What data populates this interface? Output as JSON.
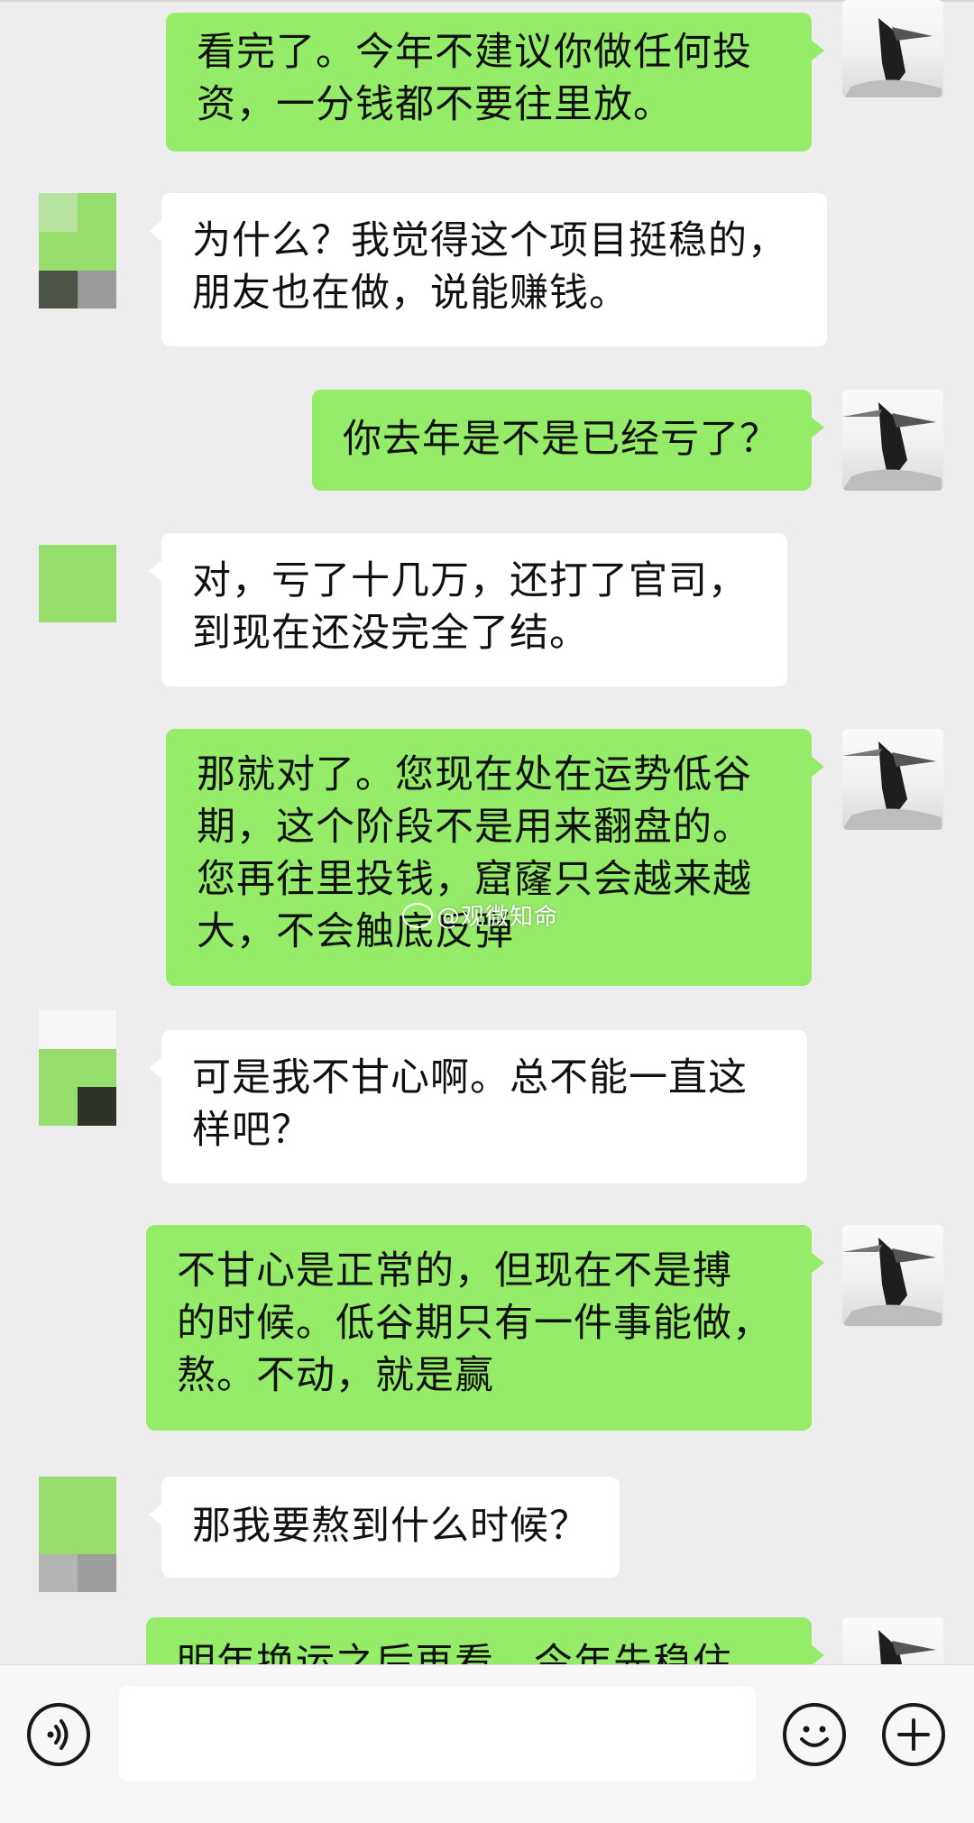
{
  "messages": [
    {
      "side": "out",
      "text": "看完了。今年不建议你做任何投\n资，一分钱都不要往里放。"
    },
    {
      "side": "in",
      "text": "为什么？我觉得这个项目挺稳的，\n朋友也在做，说能赚钱。"
    },
    {
      "side": "out",
      "text": "你去年是不是已经亏了？"
    },
    {
      "side": "in",
      "text": "对，亏了十几万，还打了官司，\n到现在还没完全了结。"
    },
    {
      "side": "out",
      "text": "那就对了。您现在处在运势低谷\n期，这个阶段不是用来翻盘的。\n您再往里投钱，窟窿只会越来越\n大，不会触底反弹"
    },
    {
      "side": "in",
      "text": "可是我不甘心啊。总不能一直这\n样吧？"
    },
    {
      "side": "out",
      "text": "不甘心是正常的，但现在不是搏\n的时候。低谷期只有一件事能做，\n熬。不动，就是赢"
    },
    {
      "side": "in",
      "text": "那我要熬到什么时候？"
    },
    {
      "side": "out",
      "text": "明年换运之后再看，今年先稳住"
    }
  ],
  "watermark": "@观微知命",
  "input_bar": {
    "voice_icon": "voice-icon",
    "emoji_icon": "emoji-icon",
    "plus_icon": "plus-icon",
    "input_value": ""
  },
  "colors": {
    "outgoing_bubble": "#95ec69",
    "incoming_bubble": "#ffffff",
    "background": "#ededed"
  }
}
